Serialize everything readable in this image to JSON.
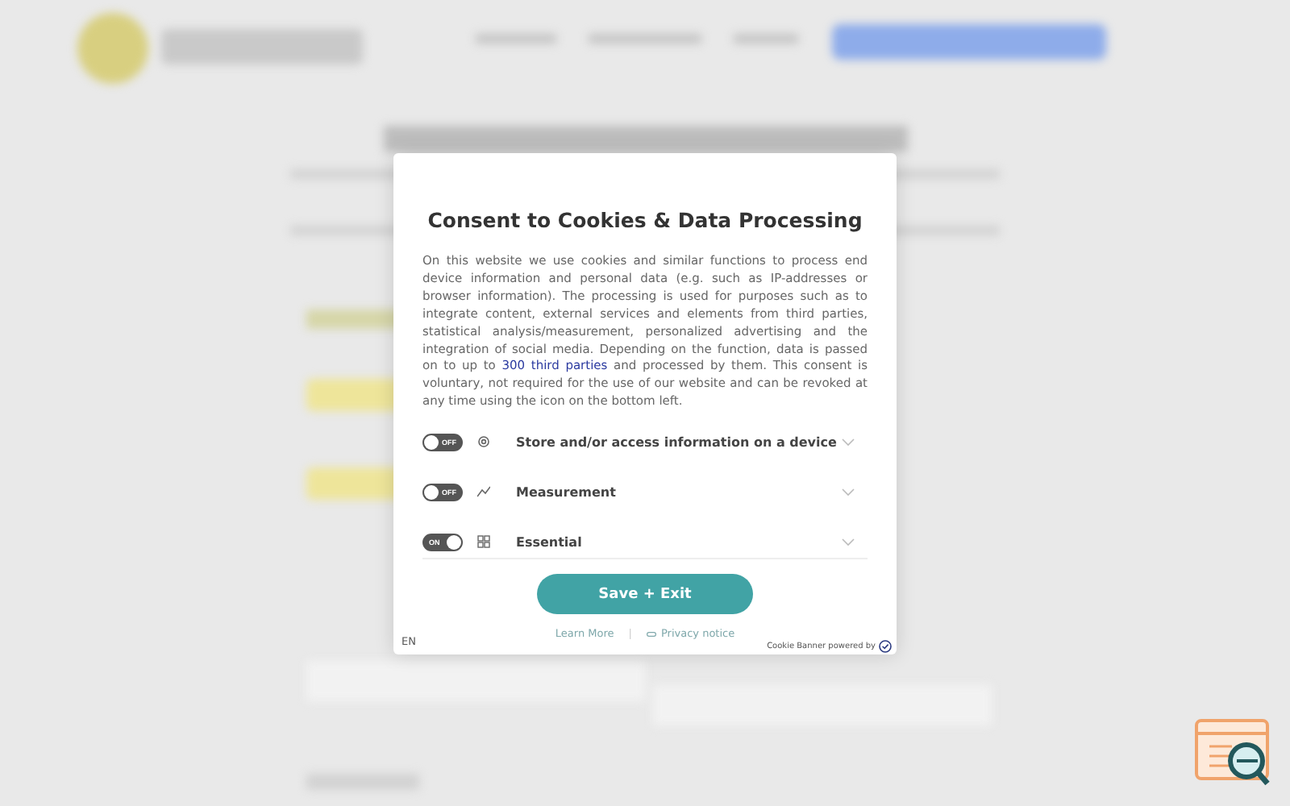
{
  "dialog": {
    "title": "Consent to Cookies & Data Processing",
    "body": "On this website we use cookies and similar functions to process end device information and personal data (e.g. such as IP-addresses or browser information). The processing is used for purposes such as to integrate content, external services and elements from third parties, statistical analysis/measurement, personalized advertising and the integration of social media. Depending on the function, data is passed on to up to ",
    "body_link": "300 third parties",
    "body_end": " and processed by them. This consent is voluntary, not required for the use of our website and can be revoked at any time using the icon on the bottom left.",
    "categories": [
      {
        "label": "Store and/or access information on a device",
        "on": false,
        "toggle_text": "OFF",
        "kind": "device"
      },
      {
        "label": "Measurement",
        "on": false,
        "toggle_text": "OFF",
        "kind": "measure"
      },
      {
        "label": "Essential",
        "on": true,
        "toggle_text": "ON",
        "kind": "essential"
      }
    ],
    "save_button": "Save + Exit",
    "learn_more": "Learn More",
    "separator": "|",
    "privacy": "Privacy notice",
    "language": "EN",
    "powered_by": "Cookie Banner powered by"
  }
}
